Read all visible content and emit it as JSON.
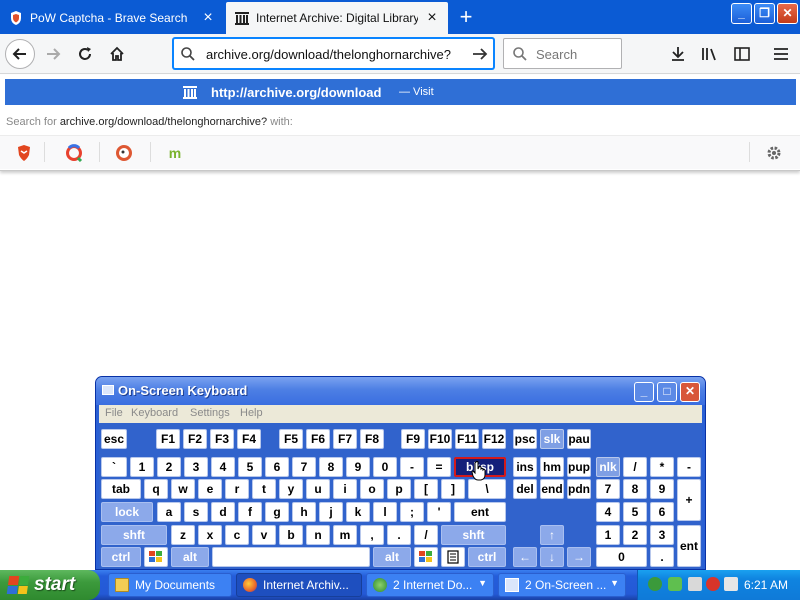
{
  "browser": {
    "tabs": [
      {
        "title": "PoW Captcha - Brave Search",
        "icon": "brave-shield-icon",
        "active": false
      },
      {
        "title": "Internet Archive: Digital Library of",
        "icon": "archive-building-icon",
        "active": true
      }
    ],
    "url": "archive.org/download/thelonghornarchive?",
    "search_placeholder": "Search",
    "suggestion": {
      "url": "http://archive.org/download",
      "action": "— Visit"
    },
    "search_for": {
      "prefix": "Search for",
      "query": "archive.org/download/thelonghornarchive?",
      "suffix": "with:"
    },
    "engines": [
      "brave-icon",
      "qwant-icon",
      "duckduckgo-icon",
      "mojeek-icon"
    ],
    "colors": {
      "tabstrip": "#0b5bd4",
      "accent": "#0a84ff",
      "suggestion_bg": "#2f6fd6"
    }
  },
  "osk": {
    "title": "On-Screen Keyboard",
    "menu": [
      "File",
      "Keyboard",
      "Settings",
      "Help"
    ],
    "rows": [
      [
        "esc",
        "F1",
        "F2",
        "F3",
        "F4",
        "F5",
        "F6",
        "F7",
        "F8",
        "F9",
        "F10",
        "F11",
        "F12",
        "psc",
        "slk",
        "pau"
      ],
      [
        "`",
        "1",
        "2",
        "3",
        "4",
        "5",
        "6",
        "7",
        "8",
        "9",
        "0",
        "-",
        "=",
        "bksp",
        "ins",
        "hm",
        "pup",
        "nlk",
        "/",
        "*",
        "-"
      ],
      [
        "tab",
        "q",
        "w",
        "e",
        "r",
        "t",
        "y",
        "u",
        "i",
        "o",
        "p",
        "[",
        "]",
        "\\",
        "del",
        "end",
        "pdn",
        "7",
        "8",
        "9",
        "+"
      ],
      [
        "lock",
        "a",
        "s",
        "d",
        "f",
        "g",
        "h",
        "j",
        "k",
        "l",
        ";",
        "'",
        "ent",
        "4",
        "5",
        "6"
      ],
      [
        "shft",
        "z",
        "x",
        "c",
        "v",
        "b",
        "n",
        "m",
        ",",
        ".",
        "/",
        "shft",
        "↑",
        "1",
        "2",
        "3",
        "ent"
      ],
      [
        "ctrl",
        "alt",
        "alt",
        "ctrl",
        "←",
        "↓",
        "→",
        "0",
        "."
      ]
    ],
    "highlighted_key": "bksp"
  },
  "taskbar": {
    "start_label": "start",
    "items": [
      {
        "label": "My Documents",
        "icon": "folder-icon",
        "active": false
      },
      {
        "label": "Internet Archiv...",
        "icon": "firefox-icon",
        "active": true
      },
      {
        "label": "2 Internet Do...",
        "icon": "ie-icon",
        "active": false,
        "grouped": true
      },
      {
        "label": "2 On-Screen ...",
        "icon": "keyboard-icon",
        "active": false,
        "grouped": true
      }
    ],
    "clock": "6:21 AM"
  }
}
